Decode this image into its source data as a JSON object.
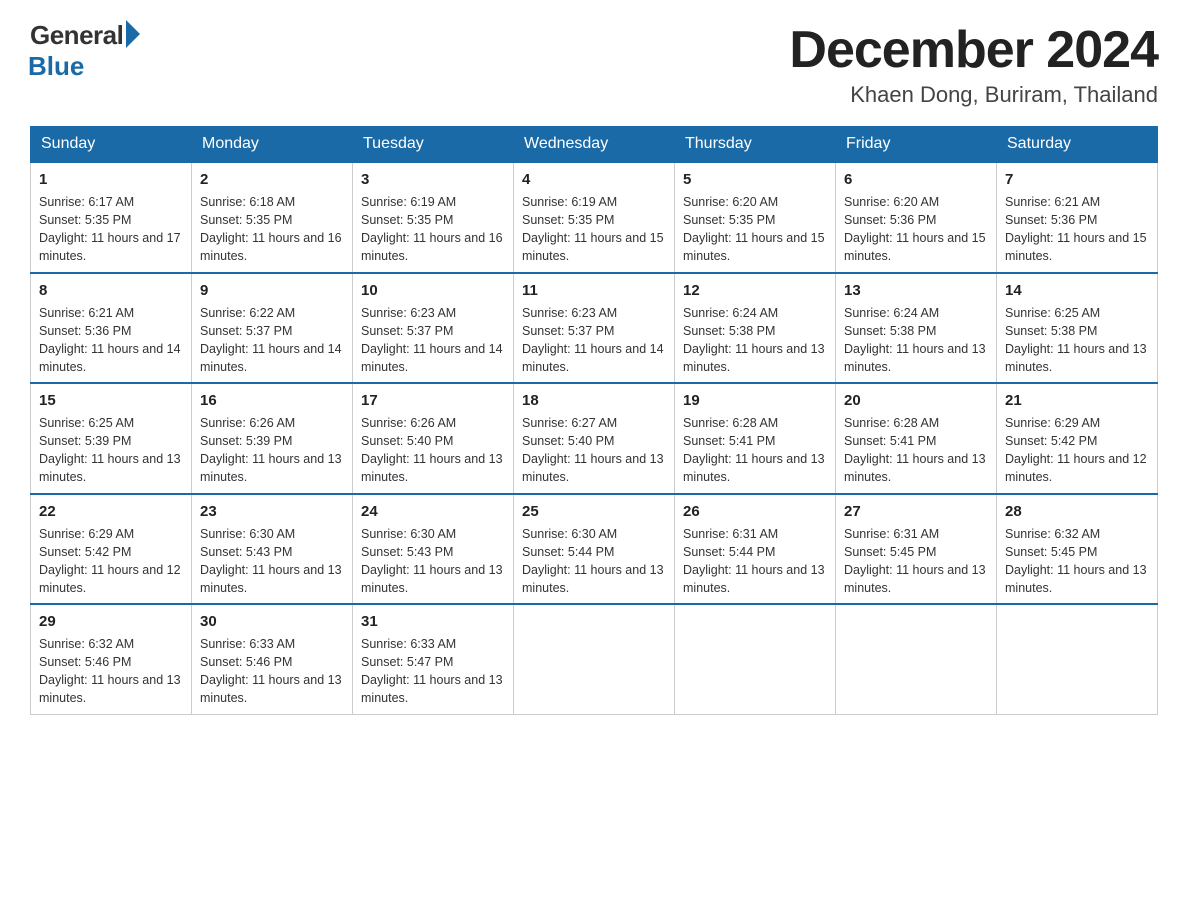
{
  "header": {
    "logo": {
      "general": "General",
      "blue": "Blue"
    },
    "title": "December 2024",
    "location": "Khaen Dong, Buriram, Thailand"
  },
  "calendar": {
    "days_of_week": [
      "Sunday",
      "Monday",
      "Tuesday",
      "Wednesday",
      "Thursday",
      "Friday",
      "Saturday"
    ],
    "weeks": [
      [
        {
          "day": "1",
          "sunrise": "6:17 AM",
          "sunset": "5:35 PM",
          "daylight": "11 hours and 17 minutes."
        },
        {
          "day": "2",
          "sunrise": "6:18 AM",
          "sunset": "5:35 PM",
          "daylight": "11 hours and 16 minutes."
        },
        {
          "day": "3",
          "sunrise": "6:19 AM",
          "sunset": "5:35 PM",
          "daylight": "11 hours and 16 minutes."
        },
        {
          "day": "4",
          "sunrise": "6:19 AM",
          "sunset": "5:35 PM",
          "daylight": "11 hours and 15 minutes."
        },
        {
          "day": "5",
          "sunrise": "6:20 AM",
          "sunset": "5:35 PM",
          "daylight": "11 hours and 15 minutes."
        },
        {
          "day": "6",
          "sunrise": "6:20 AM",
          "sunset": "5:36 PM",
          "daylight": "11 hours and 15 minutes."
        },
        {
          "day": "7",
          "sunrise": "6:21 AM",
          "sunset": "5:36 PM",
          "daylight": "11 hours and 15 minutes."
        }
      ],
      [
        {
          "day": "8",
          "sunrise": "6:21 AM",
          "sunset": "5:36 PM",
          "daylight": "11 hours and 14 minutes."
        },
        {
          "day": "9",
          "sunrise": "6:22 AM",
          "sunset": "5:37 PM",
          "daylight": "11 hours and 14 minutes."
        },
        {
          "day": "10",
          "sunrise": "6:23 AM",
          "sunset": "5:37 PM",
          "daylight": "11 hours and 14 minutes."
        },
        {
          "day": "11",
          "sunrise": "6:23 AM",
          "sunset": "5:37 PM",
          "daylight": "11 hours and 14 minutes."
        },
        {
          "day": "12",
          "sunrise": "6:24 AM",
          "sunset": "5:38 PM",
          "daylight": "11 hours and 13 minutes."
        },
        {
          "day": "13",
          "sunrise": "6:24 AM",
          "sunset": "5:38 PM",
          "daylight": "11 hours and 13 minutes."
        },
        {
          "day": "14",
          "sunrise": "6:25 AM",
          "sunset": "5:38 PM",
          "daylight": "11 hours and 13 minutes."
        }
      ],
      [
        {
          "day": "15",
          "sunrise": "6:25 AM",
          "sunset": "5:39 PM",
          "daylight": "11 hours and 13 minutes."
        },
        {
          "day": "16",
          "sunrise": "6:26 AM",
          "sunset": "5:39 PM",
          "daylight": "11 hours and 13 minutes."
        },
        {
          "day": "17",
          "sunrise": "6:26 AM",
          "sunset": "5:40 PM",
          "daylight": "11 hours and 13 minutes."
        },
        {
          "day": "18",
          "sunrise": "6:27 AM",
          "sunset": "5:40 PM",
          "daylight": "11 hours and 13 minutes."
        },
        {
          "day": "19",
          "sunrise": "6:28 AM",
          "sunset": "5:41 PM",
          "daylight": "11 hours and 13 minutes."
        },
        {
          "day": "20",
          "sunrise": "6:28 AM",
          "sunset": "5:41 PM",
          "daylight": "11 hours and 13 minutes."
        },
        {
          "day": "21",
          "sunrise": "6:29 AM",
          "sunset": "5:42 PM",
          "daylight": "11 hours and 12 minutes."
        }
      ],
      [
        {
          "day": "22",
          "sunrise": "6:29 AM",
          "sunset": "5:42 PM",
          "daylight": "11 hours and 12 minutes."
        },
        {
          "day": "23",
          "sunrise": "6:30 AM",
          "sunset": "5:43 PM",
          "daylight": "11 hours and 13 minutes."
        },
        {
          "day": "24",
          "sunrise": "6:30 AM",
          "sunset": "5:43 PM",
          "daylight": "11 hours and 13 minutes."
        },
        {
          "day": "25",
          "sunrise": "6:30 AM",
          "sunset": "5:44 PM",
          "daylight": "11 hours and 13 minutes."
        },
        {
          "day": "26",
          "sunrise": "6:31 AM",
          "sunset": "5:44 PM",
          "daylight": "11 hours and 13 minutes."
        },
        {
          "day": "27",
          "sunrise": "6:31 AM",
          "sunset": "5:45 PM",
          "daylight": "11 hours and 13 minutes."
        },
        {
          "day": "28",
          "sunrise": "6:32 AM",
          "sunset": "5:45 PM",
          "daylight": "11 hours and 13 minutes."
        }
      ],
      [
        {
          "day": "29",
          "sunrise": "6:32 AM",
          "sunset": "5:46 PM",
          "daylight": "11 hours and 13 minutes."
        },
        {
          "day": "30",
          "sunrise": "6:33 AM",
          "sunset": "5:46 PM",
          "daylight": "11 hours and 13 minutes."
        },
        {
          "day": "31",
          "sunrise": "6:33 AM",
          "sunset": "5:47 PM",
          "daylight": "11 hours and 13 minutes."
        },
        null,
        null,
        null,
        null
      ]
    ]
  }
}
